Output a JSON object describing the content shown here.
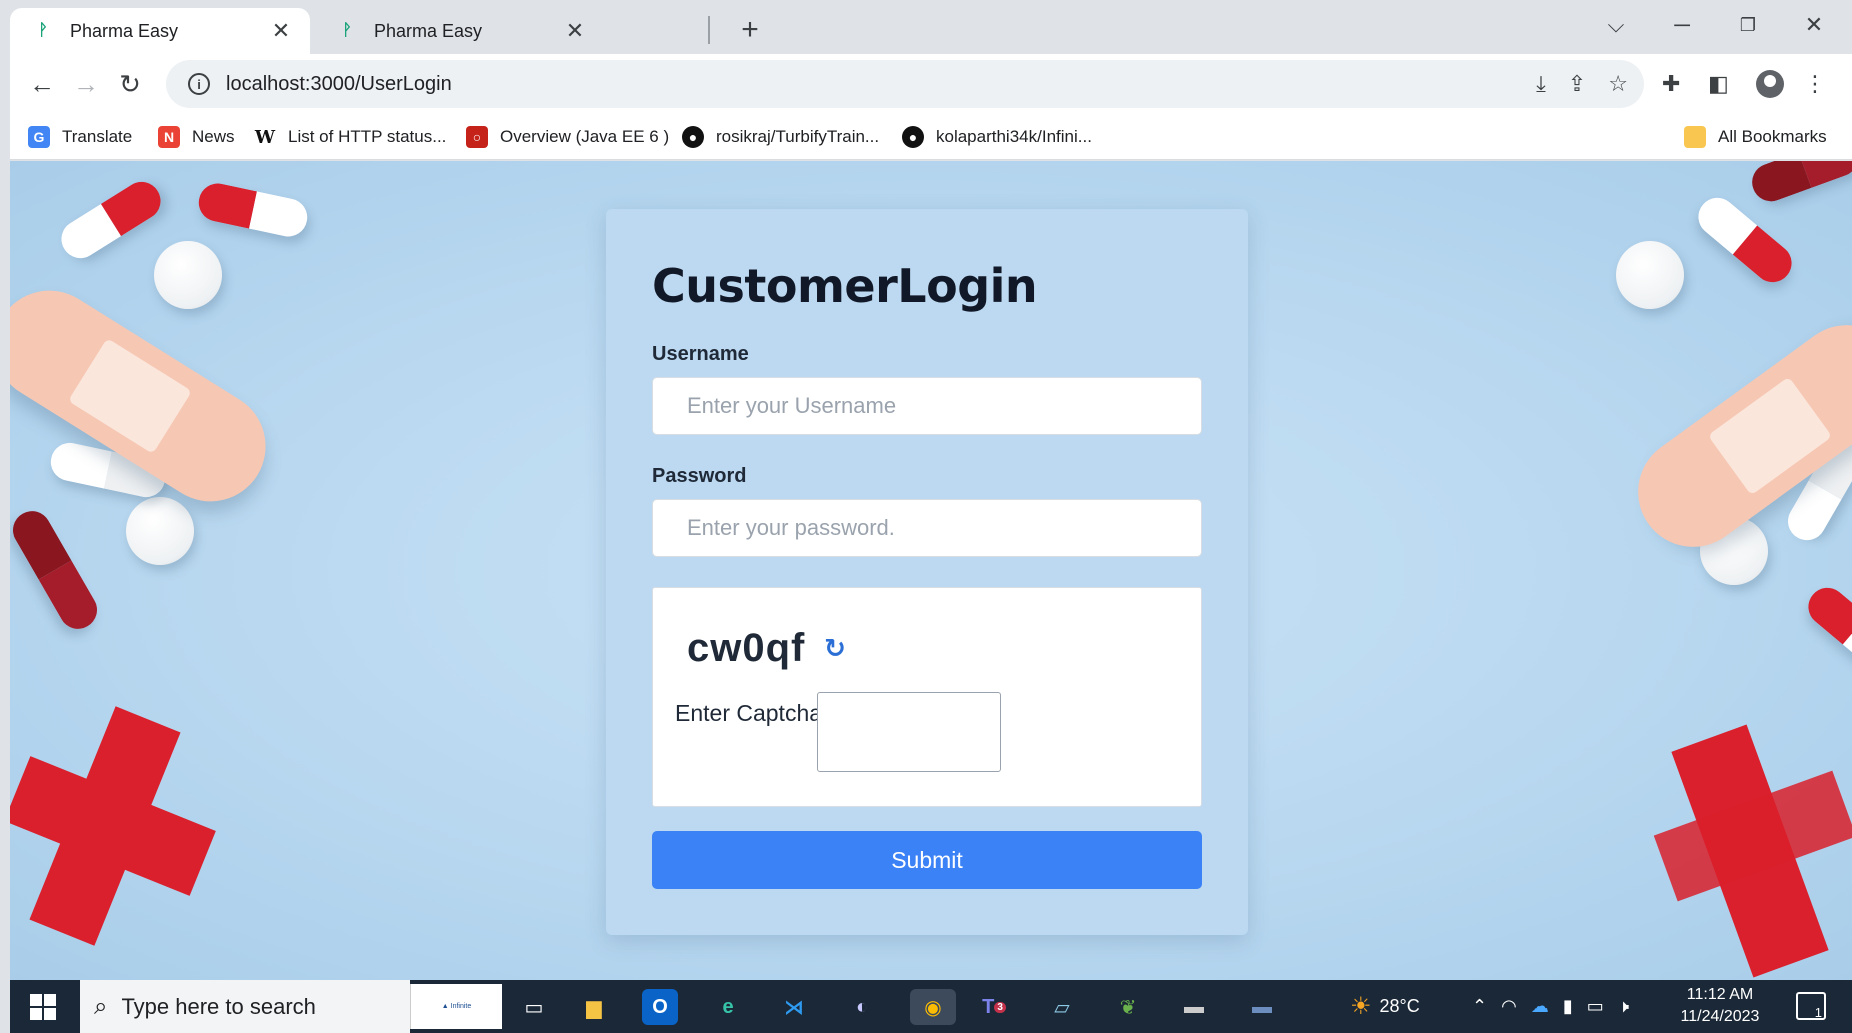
{
  "browser": {
    "tabs": [
      {
        "label": "Pharma Easy",
        "active": true
      },
      {
        "label": "Pharma Easy",
        "active": false
      }
    ],
    "new_tab_icon": "plus-icon",
    "url": "localhost:3000/UserLogin",
    "bookmarks": [
      {
        "label": "Translate",
        "icon": "google-translate-icon"
      },
      {
        "label": "News",
        "icon": "google-news-icon"
      },
      {
        "label": "List of HTTP status...",
        "icon": "wikipedia-icon"
      },
      {
        "label": "Overview (Java EE 6 )",
        "icon": "oracle-icon"
      },
      {
        "label": "rosikraj/TurbifyTrain...",
        "icon": "github-icon"
      },
      {
        "label": "kolaparthi34k/Infini...",
        "icon": "github-icon"
      }
    ],
    "all_bookmarks_label": "All Bookmarks"
  },
  "login": {
    "title": "CustomerLogin",
    "username_label": "Username",
    "username_placeholder": "Enter your Username",
    "password_label": "Password",
    "password_placeholder": "Enter your password.",
    "captcha_code": "cw0qf",
    "captcha_label": "Enter Captcha",
    "submit_label": "Submit"
  },
  "taskbar": {
    "search_placeholder": "Type here to search",
    "weather": "28°C",
    "time": "11:12 AM",
    "date": "11/24/2023",
    "notification_count": "1",
    "teams_badge": "3"
  },
  "colors": {
    "accent": "#3b82f6",
    "card_bg": "#bcd9f1",
    "page_bg": "#b9d8f0",
    "taskbar_bg": "#1b2838"
  }
}
